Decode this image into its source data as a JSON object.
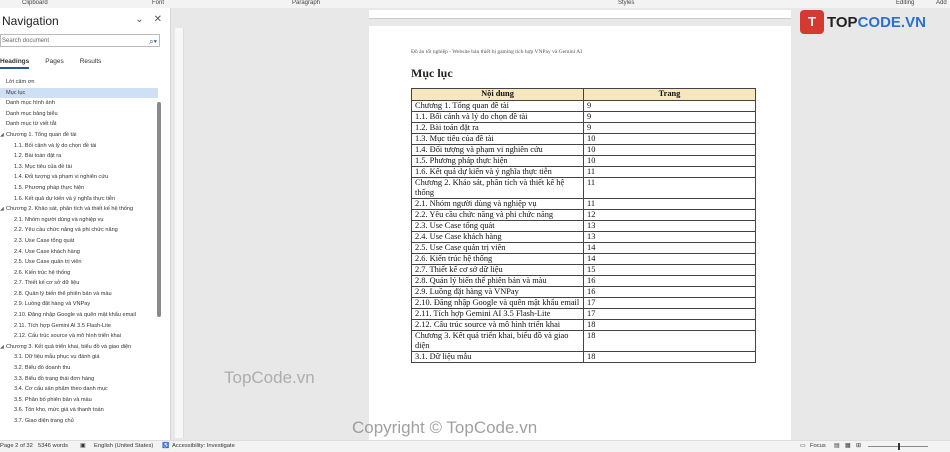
{
  "ribbon": {
    "groups": [
      "Clipboard",
      "Font",
      "Paragraph",
      "Styles",
      "Editing",
      "Add"
    ]
  },
  "nav": {
    "title": "Navigation",
    "search_placeholder": "Search document",
    "tabs": [
      "Headings",
      "Pages",
      "Results"
    ],
    "items": [
      {
        "label": "Lời cảm ơn",
        "level": 1,
        "caret": false,
        "selected": false
      },
      {
        "label": "Mục lục",
        "level": 1,
        "caret": false,
        "selected": true
      },
      {
        "label": "Danh mục hình ảnh",
        "level": 1,
        "caret": false,
        "selected": false
      },
      {
        "label": "Danh mục bảng biểu",
        "level": 1,
        "caret": false,
        "selected": false
      },
      {
        "label": "Danh mục từ viết tắt",
        "level": 1,
        "caret": false,
        "selected": false
      },
      {
        "label": "Chương 1. Tổng quan đề tài",
        "level": 1,
        "caret": true,
        "selected": false
      },
      {
        "label": "1.1. Bối cảnh và lý do chọn đề tài",
        "level": 2,
        "caret": false,
        "selected": false
      },
      {
        "label": "1.2. Bài toán đặt ra",
        "level": 2,
        "caret": false,
        "selected": false
      },
      {
        "label": "1.3. Mục tiêu của đề tài",
        "level": 2,
        "caret": false,
        "selected": false
      },
      {
        "label": "1.4. Đối tượng và phạm vi nghiên cứu",
        "level": 2,
        "caret": false,
        "selected": false
      },
      {
        "label": "1.5. Phương pháp thực hiện",
        "level": 2,
        "caret": false,
        "selected": false
      },
      {
        "label": "1.6. Kết quả dự kiến và ý nghĩa thực tiễn",
        "level": 2,
        "caret": false,
        "selected": false
      },
      {
        "label": "Chương 2. Khảo sát, phân tích và thiết kế hệ thống",
        "level": 1,
        "caret": true,
        "selected": false
      },
      {
        "label": "2.1. Nhóm người dùng và nghiệp vụ",
        "level": 2,
        "caret": false,
        "selected": false
      },
      {
        "label": "2.2. Yêu cầu chức năng và phi chức năng",
        "level": 2,
        "caret": false,
        "selected": false
      },
      {
        "label": "2.3. Use Case tổng quát",
        "level": 2,
        "caret": false,
        "selected": false
      },
      {
        "label": "2.4. Use Case khách hàng",
        "level": 2,
        "caret": false,
        "selected": false
      },
      {
        "label": "2.5. Use Case quản trị viên",
        "level": 2,
        "caret": false,
        "selected": false
      },
      {
        "label": "2.6. Kiến trúc hệ thống",
        "level": 2,
        "caret": false,
        "selected": false
      },
      {
        "label": "2.7. Thiết kế cơ sở dữ liệu",
        "level": 2,
        "caret": false,
        "selected": false
      },
      {
        "label": "2.8. Quản lý biến thể phiên bản và màu",
        "level": 2,
        "caret": false,
        "selected": false
      },
      {
        "label": "2.9. Luồng đặt hàng và VNPay",
        "level": 2,
        "caret": false,
        "selected": false
      },
      {
        "label": "2.10. Đăng nhập Google và quên mật khẩu email",
        "level": 2,
        "caret": false,
        "selected": false
      },
      {
        "label": "2.11. Tích hợp Gemini AI 3.5 Flash-Lite",
        "level": 2,
        "caret": false,
        "selected": false
      },
      {
        "label": "2.12. Cấu trúc source và mô hình triển khai",
        "level": 2,
        "caret": false,
        "selected": false
      },
      {
        "label": "Chương 3. Kết quả triển khai, biểu đồ và giao diện",
        "level": 1,
        "caret": true,
        "selected": false
      },
      {
        "label": "3.1. Dữ liệu mẫu phục vụ đánh giá",
        "level": 2,
        "caret": false,
        "selected": false
      },
      {
        "label": "3.2. Biểu đồ doanh thu",
        "level": 2,
        "caret": false,
        "selected": false
      },
      {
        "label": "3.3. Biểu đồ trạng thái đơn hàng",
        "level": 2,
        "caret": false,
        "selected": false
      },
      {
        "label": "3.4. Cơ cấu sản phẩm theo danh mục",
        "level": 2,
        "caret": false,
        "selected": false
      },
      {
        "label": "3.5. Phân bố phiên bản và màu",
        "level": 2,
        "caret": false,
        "selected": false
      },
      {
        "label": "3.6. Tồn kho, mức giá và thanh toán",
        "level": 2,
        "caret": false,
        "selected": false
      },
      {
        "label": "3.7. Giao diện trang chủ",
        "level": 2,
        "caret": false,
        "selected": false
      }
    ]
  },
  "document": {
    "header": "Đồ án tốt nghiệp - Website bán thiết bị gaming tích hợp VNPay và Gemini AI",
    "title": "Mục lục",
    "columns": [
      "Nội dung",
      "Trang"
    ],
    "rows": [
      {
        "content": "Chương 1. Tổng quan đề tài",
        "page": "9"
      },
      {
        "content": "1.1. Bối cảnh và lý do chọn đề tài",
        "page": "9"
      },
      {
        "content": "1.2. Bài toán đặt ra",
        "page": "9"
      },
      {
        "content": "1.3. Mục tiêu của đề tài",
        "page": "10"
      },
      {
        "content": "1.4. Đối tượng và phạm vi nghiên cứu",
        "page": "10"
      },
      {
        "content": "1.5. Phương pháp thực hiện",
        "page": "10"
      },
      {
        "content": "1.6. Kết quả dự kiến và ý nghĩa thực tiễn",
        "page": "11"
      },
      {
        "content": "Chương 2. Khảo sát, phân tích và thiết kế hệ thống",
        "page": "11"
      },
      {
        "content": "2.1. Nhóm người dùng và nghiệp vụ",
        "page": "11"
      },
      {
        "content": "2.2. Yêu cầu chức năng và phi chức năng",
        "page": "12"
      },
      {
        "content": "2.3. Use Case tổng quát",
        "page": "13"
      },
      {
        "content": "2.4. Use Case khách hàng",
        "page": "13"
      },
      {
        "content": "2.5. Use Case quản trị viên",
        "page": "14"
      },
      {
        "content": "2.6. Kiến trúc hệ thống",
        "page": "14"
      },
      {
        "content": "2.7. Thiết kế cơ sở dữ liệu",
        "page": "15"
      },
      {
        "content": "2.8. Quản lý biến thể phiên bản và màu",
        "page": "16"
      },
      {
        "content": "2.9. Luồng đặt hàng và VNPay",
        "page": "16"
      },
      {
        "content": "2.10. Đăng nhập Google và quên mật khẩu email",
        "page": "17"
      },
      {
        "content": "2.11. Tích hợp Gemini AI 3.5 Flash-Lite",
        "page": "17"
      },
      {
        "content": "2.12. Cấu trúc source và mô hình triển khai",
        "page": "18"
      },
      {
        "content": "Chương 3. Kết quả triển khai, biểu đồ và giao diện",
        "page": "18"
      },
      {
        "content": "3.1. Dữ liệu mẫu",
        "page": "18"
      }
    ]
  },
  "watermarks": {
    "left": "TopCode.vn",
    "bottom": "Copyright © TopCode.vn"
  },
  "logo": {
    "mark": "T",
    "text_a": "TOP",
    "text_b": "CODE.VN"
  },
  "status": {
    "page": "Page 2 of 32",
    "words": "5346 words",
    "language": "English (United States)",
    "accessibility": "Accessibility: Investigate",
    "focus": "Focus"
  },
  "colors": {
    "header_fill": "#f7e7c1",
    "selected_nav": "#cfe0f4",
    "logo_red": "#d43a2f"
  }
}
